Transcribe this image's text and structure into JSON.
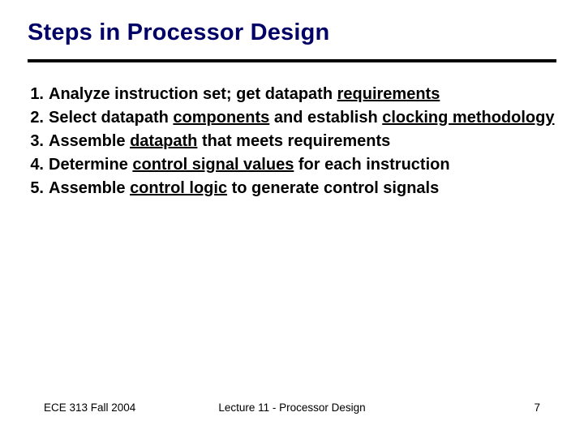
{
  "title": "Steps in Processor Design",
  "items": [
    {
      "num": "1.",
      "pre": "Analyze instruction set; get datapath ",
      "u1": "requirements",
      "mid": "",
      "u2": "",
      "post": ""
    },
    {
      "num": "2.",
      "pre": "Select datapath ",
      "u1": "components",
      "mid": " and establish ",
      "u2": "clocking methodology",
      "post": ""
    },
    {
      "num": "3.",
      "pre": "Assemble ",
      "u1": "datapath",
      "mid": " that meets requirements",
      "u2": "",
      "post": ""
    },
    {
      "num": "4.",
      "pre": "Determine ",
      "u1": "control signal values",
      "mid": " for each instruction",
      "u2": "",
      "post": ""
    },
    {
      "num": "5.",
      "pre": "Assemble ",
      "u1": "control logic",
      "mid": " to generate control signals",
      "u2": "",
      "post": ""
    }
  ],
  "footer": {
    "left": "ECE 313 Fall 2004",
    "center": "Lecture 11 - Processor Design",
    "right": "7"
  }
}
